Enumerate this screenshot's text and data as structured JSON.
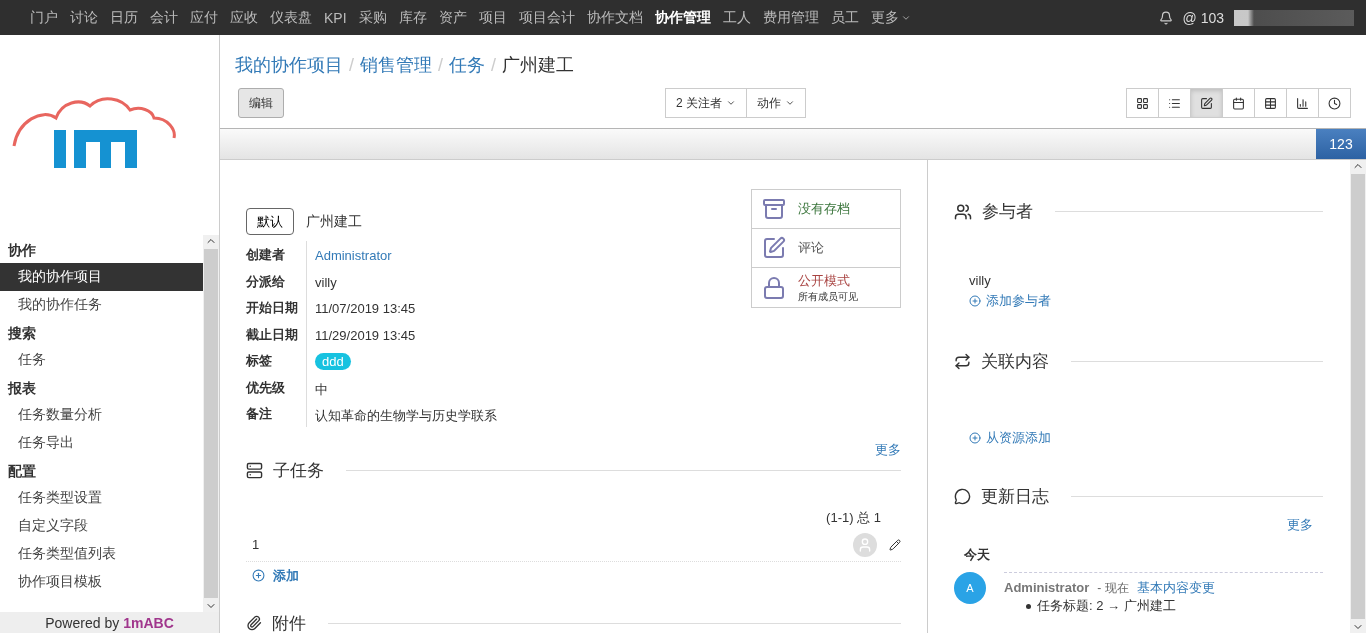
{
  "top_nav": {
    "items": [
      {
        "label": "门户",
        "selected": false
      },
      {
        "label": "讨论",
        "selected": false
      },
      {
        "label": "日历",
        "selected": false
      },
      {
        "label": "会计",
        "selected": false
      },
      {
        "label": "应付",
        "selected": false
      },
      {
        "label": "应收",
        "selected": false
      },
      {
        "label": "仪表盘",
        "selected": false
      },
      {
        "label": "KPI",
        "selected": false
      },
      {
        "label": "采购",
        "selected": false
      },
      {
        "label": "库存",
        "selected": false
      },
      {
        "label": "资产",
        "selected": false
      },
      {
        "label": "项目",
        "selected": false
      },
      {
        "label": "项目会计",
        "selected": false
      },
      {
        "label": "协作文档",
        "selected": false
      },
      {
        "label": "协作管理",
        "selected": true
      },
      {
        "label": "工人",
        "selected": false
      },
      {
        "label": "费用管理",
        "selected": false
      },
      {
        "label": "员工",
        "selected": false
      }
    ],
    "more": "更多",
    "mentions": "@ 103"
  },
  "sidebar": {
    "sections": [
      {
        "title": "协作",
        "items": [
          {
            "label": "我的协作项目",
            "selected": true
          },
          {
            "label": "我的协作任务",
            "selected": false
          }
        ]
      },
      {
        "title": "搜索",
        "items": [
          {
            "label": "任务",
            "selected": false
          }
        ]
      },
      {
        "title": "报表",
        "items": [
          {
            "label": "任务数量分析",
            "selected": false
          },
          {
            "label": "任务导出",
            "selected": false
          }
        ]
      },
      {
        "title": "配置",
        "items": [
          {
            "label": "任务类型设置",
            "selected": false
          },
          {
            "label": "自定义字段",
            "selected": false
          },
          {
            "label": "任务类型值列表",
            "selected": false
          },
          {
            "label": "协作项目模板",
            "selected": false
          }
        ]
      }
    ],
    "footer": {
      "text": "Powered by",
      "brand": "1mABC"
    }
  },
  "breadcrumb": {
    "separator": "/",
    "items": [
      "我的协作项目",
      "销售管理",
      "任务",
      "广州建工"
    ]
  },
  "toolbar": {
    "edit_button": "编辑",
    "followers_button": "2 关注者",
    "actions_button": "动作",
    "views": [
      {
        "kind": "kanban",
        "selected": false
      },
      {
        "kind": "list",
        "selected": false
      },
      {
        "kind": "form",
        "selected": true
      },
      {
        "kind": "calendar",
        "selected": false
      },
      {
        "kind": "grid",
        "selected": false
      },
      {
        "kind": "graph",
        "selected": false
      },
      {
        "kind": "timeline",
        "selected": false
      }
    ]
  },
  "status_bar": {
    "badge": "123"
  },
  "record": {
    "stage_button": "默认",
    "title": "广州建工",
    "fields": [
      {
        "label": "创建者",
        "value": "Administrator",
        "kind": "link"
      },
      {
        "label": "分派给",
        "value": "villy",
        "kind": "text"
      },
      {
        "label": "开始日期",
        "value": "11/07/2019 13:45",
        "kind": "text"
      },
      {
        "label": "截止日期",
        "value": "11/29/2019 13:45",
        "kind": "text"
      },
      {
        "label": "标签",
        "value": "ddd",
        "kind": "tag"
      },
      {
        "label": "优先级",
        "value": "中",
        "kind": "text"
      },
      {
        "label": "备注",
        "value": "认知革命的生物学与历史学联系",
        "kind": "text"
      }
    ],
    "more_link": "更多"
  },
  "smart_buttons": [
    {
      "kind": "archive",
      "label": "没有存档",
      "color": "#3c763d"
    },
    {
      "kind": "comment",
      "label": "评论",
      "color": "#555555"
    },
    {
      "kind": "lock",
      "label": "公开模式",
      "sublabel": "所有成员可见",
      "color": "#a94442"
    }
  ],
  "subtasks": {
    "title": "子任务",
    "pager": "(1-1) 总 1",
    "rows": [
      {
        "name": "1"
      }
    ],
    "add": "添加"
  },
  "attachments": {
    "title": "附件"
  },
  "participants": {
    "title": "参与者",
    "members": [
      "villy"
    ],
    "add": "添加参与者"
  },
  "related": {
    "title": "关联内容",
    "add": "从资源添加"
  },
  "log": {
    "title": "更新日志",
    "more": "更多",
    "day": "今天",
    "entries": [
      {
        "avatar": "A",
        "author": "Administrator",
        "time": "- 现在",
        "action": "基本内容变更",
        "changes": [
          "任务标题: 2 → 广州建工"
        ]
      }
    ]
  }
}
